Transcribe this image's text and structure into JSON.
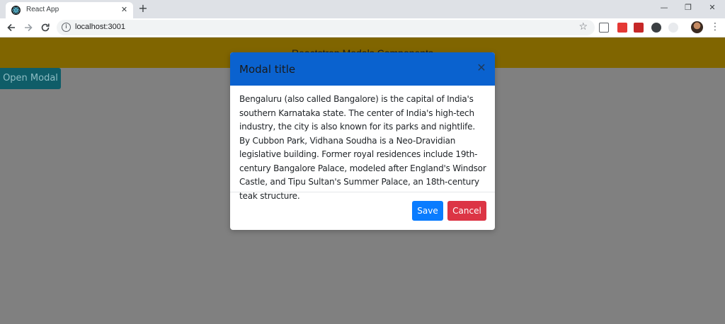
{
  "browser": {
    "tab_title": "React App",
    "tab_close": "✕",
    "new_tab": "+",
    "url": "localhost:3001",
    "window_controls": {
      "minimize": "—",
      "restore": "❐",
      "close": "✕"
    },
    "icons": [
      "back-arrow-icon",
      "forward-arrow-icon",
      "reload-icon",
      "info-icon",
      "star-icon",
      "screenshot-extension-icon",
      "pocket-extension-icon",
      "red-extension-icon",
      "dark-mode-extension-icon",
      "ghost-extension-icon",
      "profile-avatar",
      "menu-dots-icon"
    ]
  },
  "page": {
    "header_title": "Reactstrap Modals Components",
    "open_modal_label": "Open Modal",
    "header_color": "#806500",
    "backdrop_color": "#808080"
  },
  "modal": {
    "title": "Modal title",
    "close_glyph": "✕",
    "body": "Bengaluru (also called Bangalore) is the capital of India's southern Karnataka state. The center of India's high-tech industry, the city is also known for its parks and nightlife. By Cubbon Park, Vidhana Soudha is a Neo-Dravidian legislative building. Former royal residences include 19th-century Bangalore Palace, modeled after England's Windsor Castle, and Tipu Sultan's Summer Palace, an 18th-century teak structure.",
    "save_label": "Save",
    "cancel_label": "Cancel",
    "header_color": "#0a62cf",
    "save_color": "#0a7cff",
    "cancel_color": "#dc3545"
  }
}
